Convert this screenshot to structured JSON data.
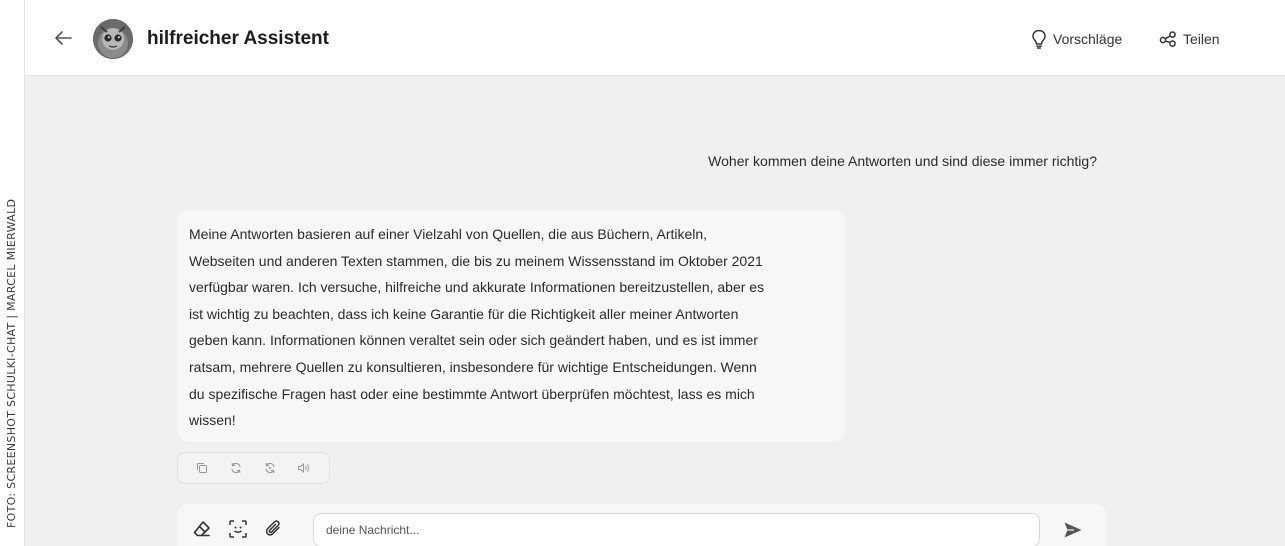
{
  "credit": "FOTO: SCREENSHOT SCHULKI-CHAT | MARCEL MIERWALD",
  "header": {
    "title": "hilfreicher Assistent",
    "suggestions_label": "Vorschläge",
    "share_label": "Teilen"
  },
  "messages": {
    "user": "Woher kommen deine Antworten und sind diese immer richtig?",
    "assistant_lines": [
      "Meine Antworten basieren auf einer Vielzahl von Quellen, die aus Büchern, Artikeln,",
      "Webseiten und anderen Texten stammen, die bis zu meinem Wissensstand im Oktober 2021",
      "verfügbar waren. Ich versuche, hilfreiche und akkurate Informationen bereitzustellen, aber es",
      "ist wichtig zu beachten, dass ich keine Garantie für die Richtigkeit aller meiner Antworten",
      "geben kann. Informationen können veraltet sein oder sich geändert haben, und es ist immer",
      "ratsam, mehrere Quellen zu konsultieren, insbesondere für wichtige Entscheidungen. Wenn",
      "du spezifische Fragen hast oder eine bestimmte Antwort überprüfen möchtest, lass es mich",
      "wissen!"
    ]
  },
  "composer": {
    "placeholder": "deine Nachricht..."
  },
  "icons": {
    "back": "arrow-left-icon",
    "suggestions": "lightbulb-icon",
    "share": "share-icon",
    "copy": "copy-icon",
    "regenerate": "refresh-icon",
    "regenerate_alt": "refresh-alt-icon",
    "speak": "speaker-icon",
    "eraser": "eraser-icon",
    "scan": "scan-icon",
    "attach": "paperclip-icon",
    "send": "send-icon"
  }
}
